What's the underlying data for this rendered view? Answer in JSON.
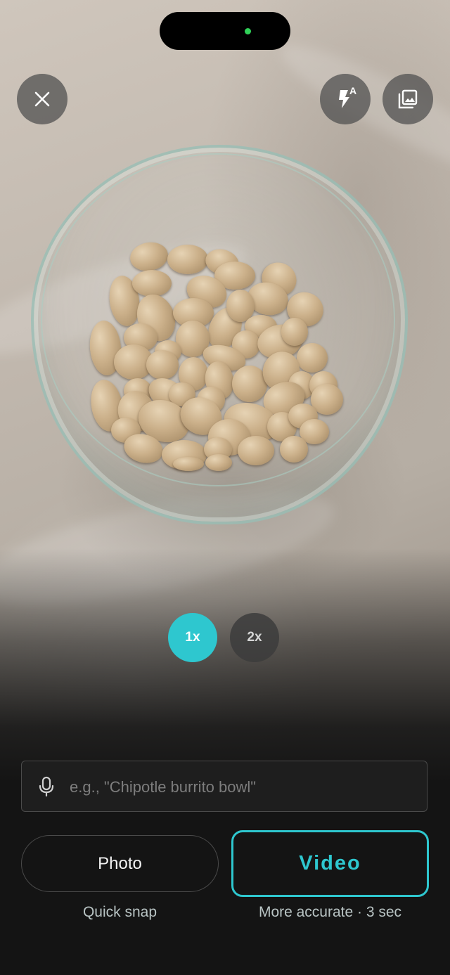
{
  "camera": {
    "zoom_options": [
      "1x",
      "2x"
    ],
    "selected_zoom": "1x",
    "flash_mode_badge": "A"
  },
  "top_bar": {
    "close_icon": "close-icon",
    "flash_icon": "flash-auto-icon",
    "gallery_icon": "gallery-icon"
  },
  "description_input": {
    "value": "",
    "placeholder": "e.g., \"Chipotle burrito bowl\"",
    "icon": "microphone-icon"
  },
  "modes": {
    "photo": {
      "label": "Photo",
      "sublabel": "Quick snap"
    },
    "video": {
      "label": "Video",
      "sublabel": "More accurate · 3 sec"
    }
  },
  "colors": {
    "accent": "#2ec7cf",
    "background": "#141414",
    "status_dot": "#30d158"
  }
}
